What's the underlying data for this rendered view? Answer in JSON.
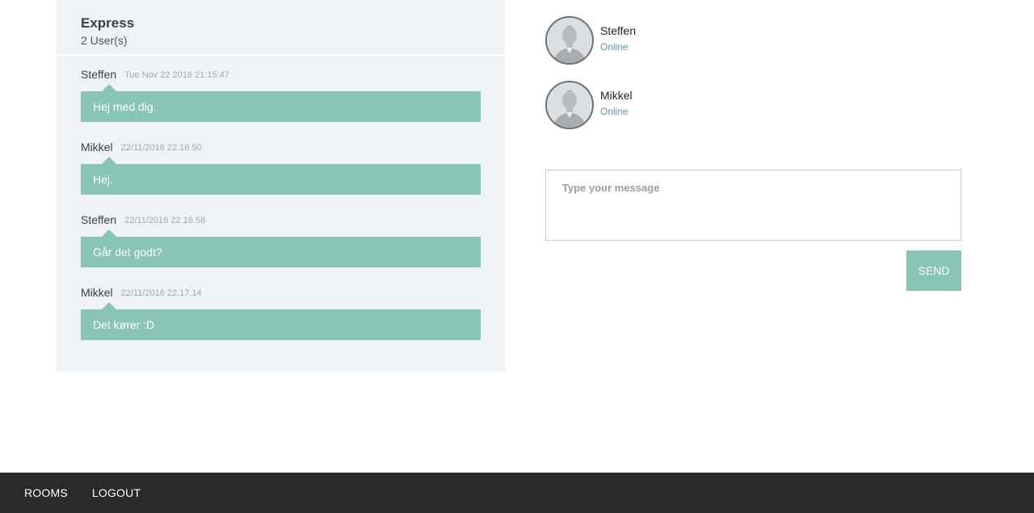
{
  "room": {
    "name": "Express",
    "user_count": "2 User(s)"
  },
  "messages": [
    {
      "author": "Steffen",
      "time": "Tue Nov 22 2016 21:15:47",
      "text": "Hej med dig."
    },
    {
      "author": "Mikkel",
      "time": "22/11/2016 22.16.50",
      "text": "Hej."
    },
    {
      "author": "Steffen",
      "time": "22/11/2016 22.16.58",
      "text": "Går det godt?"
    },
    {
      "author": "Mikkel",
      "time": "22/11/2016 22.17.14",
      "text": "Det kører :D"
    }
  ],
  "users": [
    {
      "name": "Steffen",
      "status": "Online",
      "avatar_icon": "user-avatar-icon"
    },
    {
      "name": "Mikkel",
      "status": "Online",
      "avatar_icon": "user-avatar-icon"
    }
  ],
  "composer": {
    "placeholder": "Type your message",
    "value": "",
    "send_label": "SEND"
  },
  "footer": {
    "rooms_label": "ROOMS",
    "logout_label": "LOGOUT"
  },
  "colors": {
    "accent": "#88c5b4",
    "panel_bg": "#f0f3f6",
    "footer_bg": "#2a2a2a",
    "status_online": "#5a9ca5"
  }
}
